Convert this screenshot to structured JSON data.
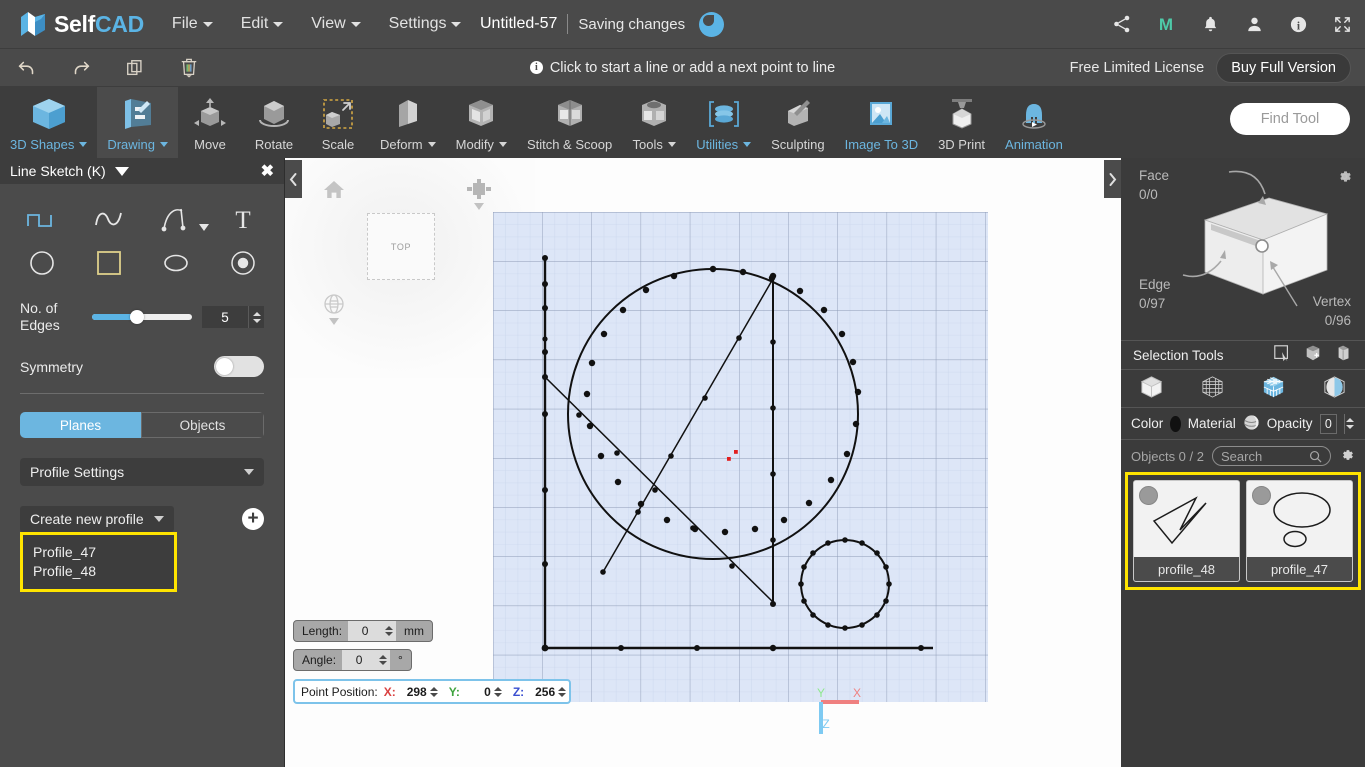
{
  "app": {
    "brand_self": "Self",
    "brand_cad": "CAD",
    "accent_blue": "#5bb4e5",
    "highlight_yellow": "#ffe400",
    "panel_dark": "#3d3d3d"
  },
  "menubar": {
    "items": [
      {
        "label": "File",
        "icon": "chevron-down-icon"
      },
      {
        "label": "Edit",
        "icon": "chevron-down-icon"
      },
      {
        "label": "View",
        "icon": "chevron-down-icon"
      },
      {
        "label": "Settings",
        "icon": "chevron-down-icon"
      }
    ],
    "document_title": "Untitled-57",
    "save_status": "Saving changes",
    "icons": [
      "share-icon",
      "maker-m-icon",
      "bell-icon",
      "user-icon",
      "info-icon",
      "fullscreen-icon"
    ]
  },
  "subbar": {
    "undo_icon": "undo-icon",
    "redo_icon": "redo-icon",
    "copy_icon": "copy-icon",
    "delete_icon": "trash-icon",
    "hint": "Click to start a line or add a next point to line",
    "license_text": "Free Limited License",
    "buy_label": "Buy Full Version"
  },
  "ribbon": {
    "tools": [
      {
        "label": "3D Shapes",
        "icon": "cube-icon",
        "caret": true,
        "active": false,
        "blue": true
      },
      {
        "label": "Drawing",
        "icon": "drawing-icon",
        "caret": true,
        "active": true,
        "blue": true
      },
      {
        "label": "Move",
        "icon": "move-icon",
        "caret": false,
        "active": false,
        "blue": false
      },
      {
        "label": "Rotate",
        "icon": "rotate-icon",
        "caret": false,
        "active": false,
        "blue": false
      },
      {
        "label": "Scale",
        "icon": "scale-icon",
        "caret": false,
        "active": false,
        "blue": false
      },
      {
        "label": "Deform",
        "icon": "deform-icon",
        "caret": true,
        "active": false,
        "blue": false
      },
      {
        "label": "Modify",
        "icon": "modify-icon",
        "caret": true,
        "active": false,
        "blue": false
      },
      {
        "label": "Stitch & Scoop",
        "icon": "stitch-scoop-icon",
        "caret": false,
        "active": false,
        "blue": false
      },
      {
        "label": "Tools",
        "icon": "tools-icon",
        "caret": true,
        "active": false,
        "blue": false
      },
      {
        "label": "Utilities",
        "icon": "utilities-icon",
        "caret": true,
        "active": false,
        "blue": true
      },
      {
        "label": "Sculpting",
        "icon": "sculpting-icon",
        "caret": false,
        "active": false,
        "blue": false
      },
      {
        "label": "Image To 3D",
        "icon": "image-to-3d-icon",
        "caret": false,
        "active": false,
        "blue": true
      },
      {
        "label": "3D Print",
        "icon": "3d-print-icon",
        "caret": false,
        "active": false,
        "blue": false
      },
      {
        "label": "Animation",
        "icon": "animation-icon",
        "caret": false,
        "active": false,
        "blue": true
      }
    ],
    "find_tool_placeholder": "Find Tool"
  },
  "left_panel": {
    "title": "Line Sketch (K)",
    "close_icon": "close-icon",
    "dropdown_icon": "triangle-down-icon",
    "draw_tools": [
      {
        "name": "polyline-tool",
        "active": true
      },
      {
        "name": "freehand-curve-tool",
        "active": false
      },
      {
        "name": "bezier-pen-tool",
        "active": false,
        "has_caret": true
      },
      {
        "name": "text-tool",
        "active": false
      },
      {
        "name": "circle-tool",
        "active": false
      },
      {
        "name": "rectangle-tool",
        "active": false
      },
      {
        "name": "ellipse-tool",
        "active": false
      },
      {
        "name": "concentric-circle-tool",
        "active": false
      }
    ],
    "edges_label": "No. of Edges",
    "edges_value": "5",
    "edges_slider_percent": 45,
    "symmetry_label": "Symmetry",
    "symmetry_on": false,
    "seg_planes": "Planes",
    "seg_objects": "Objects",
    "seg_active": "Planes",
    "profile_settings_label": "Profile Settings",
    "create_profile_label": "Create new profile",
    "add_icon": "plus-icon",
    "profiles": [
      "Profile_47",
      "Profile_48"
    ]
  },
  "viewport": {
    "collapse_icon": "chevron-left-icon",
    "expand_icon": "chevron-right-icon",
    "home_icon": "home-icon",
    "view_cube_label": "TOP",
    "square_view_icon": "square-view-icon",
    "globe_view_icon": "globe-view-icon",
    "fields": {
      "length_label": "Length:",
      "length_value": "0",
      "length_unit": "mm",
      "angle_label": "Angle:",
      "angle_value": "0",
      "angle_unit": "°",
      "point_position_label": "Point Position:",
      "x_label": "X:",
      "x_value": "298",
      "y_label": "Y:",
      "y_value": "0",
      "z_label": "Z:",
      "z_value": "256"
    },
    "axis_gizmo": {
      "x_label": "X",
      "y_label": "Y",
      "z_label": "Z",
      "x_color": "#ef8080",
      "y_color": "#8fe88f",
      "z_color": "#7ecaf2"
    }
  },
  "right_panel": {
    "gear_icon": "gear-icon",
    "face_label": "Face",
    "face_count": "0/0",
    "edge_label": "Edge",
    "edge_count": "0/97",
    "vertex_label": "Vertex",
    "vertex_count": "0/96",
    "selection_tools_label": "Selection Tools",
    "selection_tool_icons": [
      "rect-select-icon",
      "box-add-icon",
      "box-copy-icon"
    ],
    "mode_icons": [
      "object-mode-icon",
      "wireframe-mode-icon",
      "mesh-mode-icon",
      "shaded-mode-icon"
    ],
    "color_label": "Color",
    "material_label": "Material",
    "opacity_label": "Opacity",
    "opacity_value": "0",
    "color_swatch": "#111111",
    "objects_label": "Objects 0 / 2",
    "search_placeholder": "Search",
    "search_icon": "search-icon",
    "settings_icon": "gear-icon",
    "objects": [
      {
        "name": "profile_48",
        "thumb": "polyline-sketch-thumb"
      },
      {
        "name": "profile_47",
        "thumb": "ellipse-sketch-thumb"
      }
    ]
  }
}
